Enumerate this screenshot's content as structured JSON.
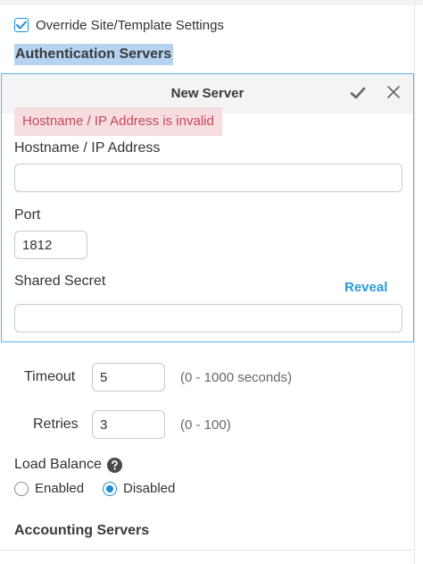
{
  "override": {
    "label": "Override Site/Template Settings",
    "checked": true
  },
  "authentication": {
    "heading": "Authentication Servers"
  },
  "new_server": {
    "title": "New Server",
    "error": "Hostname / IP Address is invalid",
    "hostname": {
      "label": "Hostname / IP Address",
      "value": ""
    },
    "port": {
      "label": "Port",
      "value": "1812"
    },
    "shared_secret": {
      "label": "Shared Secret",
      "value": "",
      "reveal_label": "Reveal"
    }
  },
  "timeout": {
    "label": "Timeout",
    "value": "5",
    "hint": "(0 - 1000 seconds)"
  },
  "retries": {
    "label": "Retries",
    "value": "3",
    "hint": "(0 - 100)"
  },
  "load_balance": {
    "label": "Load Balance",
    "options": [
      {
        "label": "Enabled",
        "selected": false
      },
      {
        "label": "Disabled",
        "selected": true
      }
    ]
  },
  "accounting": {
    "heading": "Accounting Servers"
  },
  "icons": {
    "checkbox": "checkmark-icon",
    "save": "check-icon",
    "close": "close-icon",
    "help": "help-circle-icon"
  },
  "colors": {
    "accent": "#1a8fd8",
    "panel_border": "#5cb3e6",
    "link": "#2a9ad6",
    "error_bg": "#f7dde0",
    "error_text": "#c44a57",
    "selection_highlight": "#b6d4f2"
  }
}
